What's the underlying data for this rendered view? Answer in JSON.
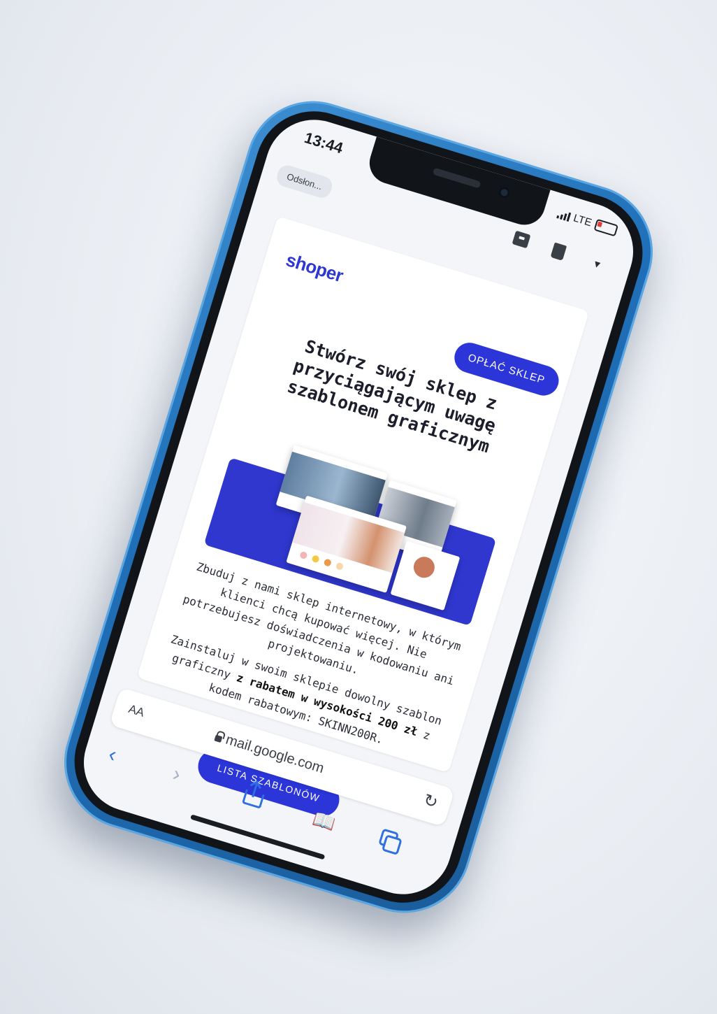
{
  "status_bar": {
    "time": "13:44",
    "network": "LTE"
  },
  "mail_toolbar": {
    "reply_label": "Odsłon..."
  },
  "email": {
    "brand": "shoper",
    "pay_button_label": "OPŁAĆ SKLEP",
    "headline": "Stwórz swój sklep z przyciągającym uwagę szablonem graficznym",
    "paragraph_1": "Zbuduj z nami sklep internetowy, w którym klienci chcą kupować więcej. Nie potrzebujesz doświadczenia w kodowaniu ani projektowaniu.",
    "paragraph_2_start": "Zainstaluj w swoim sklepie dowolny szablon graficzny",
    "paragraph_2_bold": "z rabatem w wysokości 200 zł",
    "paragraph_2_end": "z kodem rabatowym: SKINN200R.",
    "list_button_label": "LISTA SZABLONÓW"
  },
  "browser": {
    "text_size_label": "AA",
    "url": "mail.google.com"
  },
  "icons": {
    "back": "chevron-left-icon",
    "forward": "chevron-right-icon",
    "share": "share-icon",
    "bookmarks": "book-icon",
    "tabs": "tabs-icon",
    "reload": "reload-icon",
    "lock": "lock-icon"
  },
  "colors": {
    "brand_blue": "#2b35d8",
    "case_blue": "#1f6fb8",
    "safari_blue": "#2f6fe0"
  }
}
